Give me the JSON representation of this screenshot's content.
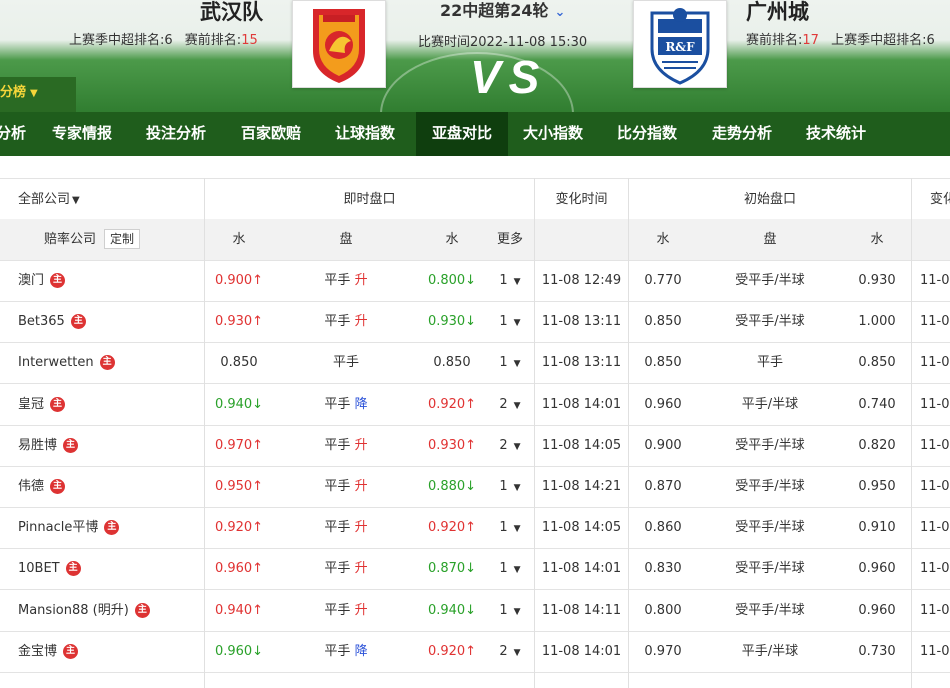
{
  "header": {
    "home": {
      "name": "武汉队",
      "last_season_label": "上赛季中超排名:6",
      "pre_rank_label": "赛前排名:",
      "pre_rank": "15"
    },
    "away": {
      "name": "广州城",
      "pre_rank_label": "赛前排名:",
      "pre_rank": "17",
      "last_season_label": "上赛季中超排名:6"
    },
    "round": "22中超第24轮",
    "round_chevron": "⌄",
    "match_time": "比赛时间2022-11-08 15:30",
    "vs": "VS",
    "away_logo_text": "R&F",
    "standings_button": "分榜",
    "standings_caret": "▼"
  },
  "nav": {
    "items": [
      "分析",
      "专家情报",
      "投注分析",
      "百家欧赔",
      "让球指数",
      "亚盘对比",
      "大小指数",
      "比分指数",
      "走势分析",
      "技术统计"
    ],
    "active_index": 5
  },
  "table": {
    "header1": {
      "company_filter": "全部公司",
      "company_filter_caret": "▼",
      "live": "即时盘口",
      "change_time": "变化时间",
      "initial": "初始盘口",
      "change_time_2": "变化"
    },
    "header2": {
      "odds_company": "赔率公司",
      "customize": "定制",
      "water1": "水",
      "handicap": "盘",
      "water2": "水",
      "more": "更多",
      "init_water1": "水",
      "init_handicap": "盘",
      "init_water2": "水"
    },
    "host_badge": "主",
    "more_caret": "▼",
    "rows": [
      {
        "company": "澳门",
        "w1": "0.900",
        "w1_dir": "up",
        "pan": "平手",
        "pan_change": "升",
        "pan_dir": "up",
        "w2": "0.800",
        "w2_dir": "down",
        "more": "1",
        "time": "11-08 12:49",
        "iw1": "0.770",
        "ipan": "受平手/半球",
        "iw2": "0.930",
        "t2": "11-0"
      },
      {
        "company": "Bet365",
        "w1": "0.930",
        "w1_dir": "up",
        "pan": "平手",
        "pan_change": "升",
        "pan_dir": "up",
        "w2": "0.930",
        "w2_dir": "down",
        "more": "1",
        "time": "11-08 13:11",
        "iw1": "0.850",
        "ipan": "受平手/半球",
        "iw2": "1.000",
        "t2": "11-0"
      },
      {
        "company": "Interwetten",
        "w1": "0.850",
        "w1_dir": "none",
        "pan": "平手",
        "pan_change": "",
        "pan_dir": "none",
        "w2": "0.850",
        "w2_dir": "none",
        "more": "1",
        "time": "11-08 13:11",
        "iw1": "0.850",
        "ipan": "平手",
        "iw2": "0.850",
        "t2": "11-0"
      },
      {
        "company": "皇冠",
        "w1": "0.940",
        "w1_dir": "down",
        "pan": "平手",
        "pan_change": "降",
        "pan_dir": "down",
        "w2": "0.920",
        "w2_dir": "up",
        "more": "2",
        "time": "11-08 14:01",
        "iw1": "0.960",
        "ipan": "平手/半球",
        "iw2": "0.740",
        "t2": "11-0"
      },
      {
        "company": "易胜博",
        "w1": "0.970",
        "w1_dir": "up",
        "pan": "平手",
        "pan_change": "升",
        "pan_dir": "up",
        "w2": "0.930",
        "w2_dir": "up",
        "more": "2",
        "time": "11-08 14:05",
        "iw1": "0.900",
        "ipan": "受平手/半球",
        "iw2": "0.820",
        "t2": "11-07"
      },
      {
        "company": "伟德",
        "w1": "0.950",
        "w1_dir": "up",
        "pan": "平手",
        "pan_change": "升",
        "pan_dir": "up",
        "w2": "0.880",
        "w2_dir": "down",
        "more": "1",
        "time": "11-08 14:21",
        "iw1": "0.870",
        "ipan": "受平手/半球",
        "iw2": "0.950",
        "t2": "11-0"
      },
      {
        "company": "Pinnacle平博",
        "w1": "0.920",
        "w1_dir": "up",
        "pan": "平手",
        "pan_change": "升",
        "pan_dir": "up",
        "w2": "0.920",
        "w2_dir": "up",
        "more": "1",
        "time": "11-08 14:05",
        "iw1": "0.860",
        "ipan": "受平手/半球",
        "iw2": "0.910",
        "t2": "11-0"
      },
      {
        "company": "10BET",
        "w1": "0.960",
        "w1_dir": "up",
        "pan": "平手",
        "pan_change": "升",
        "pan_dir": "up",
        "w2": "0.870",
        "w2_dir": "down",
        "more": "1",
        "time": "11-08 14:01",
        "iw1": "0.830",
        "ipan": "受平手/半球",
        "iw2": "0.960",
        "t2": "11-0"
      },
      {
        "company": "Mansion88 (明升)",
        "w1": "0.940",
        "w1_dir": "up",
        "pan": "平手",
        "pan_change": "升",
        "pan_dir": "up",
        "w2": "0.940",
        "w2_dir": "down",
        "more": "1",
        "time": "11-08 14:11",
        "iw1": "0.800",
        "ipan": "受平手/半球",
        "iw2": "0.960",
        "t2": "11-0"
      },
      {
        "company": "金宝博",
        "w1": "0.960",
        "w1_dir": "down",
        "pan": "平手",
        "pan_change": "降",
        "pan_dir": "down",
        "w2": "0.920",
        "w2_dir": "up",
        "more": "2",
        "time": "11-08 14:01",
        "iw1": "0.970",
        "ipan": "平手/半球",
        "iw2": "0.730",
        "t2": "11-0"
      }
    ]
  },
  "colors": {
    "up": "#e03232",
    "down": "#2aa12a",
    "jiang": "#2b52d8",
    "nav_bg": "#1f5d1c",
    "nav_active": "#0f3e0e",
    "rank_red": "#e03a3a"
  }
}
